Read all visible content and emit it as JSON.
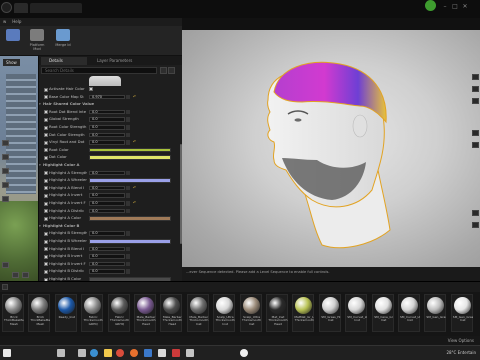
{
  "window": {
    "tab1": "",
    "tab2": "",
    "help_menu": [
      "w",
      "Help"
    ],
    "top_right_text": ""
  },
  "toolbar": {
    "tools": [
      {
        "label": "",
        "color": "#5a7bbd"
      },
      {
        "label": "Platform Mod",
        "color": "#888888"
      },
      {
        "label": "Merge Id",
        "color": "#6a9acf"
      }
    ]
  },
  "left_viewport": {
    "show_label": "Show"
  },
  "details": {
    "tab_details": "Details",
    "tab_layer": "Layer Parameters",
    "search_placeholder": "Search Details",
    "rows": [
      {
        "type": "check",
        "label": "Activate Hair Color",
        "checked": true,
        "vcheck": true
      },
      {
        "type": "value",
        "label": "Base Color Map St",
        "checked": true,
        "value": "0.970",
        "reset": true
      },
      {
        "type": "section",
        "label": "Hair Shared Color Value"
      },
      {
        "type": "value",
        "label": "Root Dot Blend Inte",
        "checked": true,
        "value": "0.0"
      },
      {
        "type": "value",
        "label": "Global Strength",
        "checked": true,
        "value": "0.0"
      },
      {
        "type": "value",
        "label": "Root Color Strength",
        "checked": true,
        "value": "0.0"
      },
      {
        "type": "value",
        "label": "Dot Color Strength",
        "checked": true,
        "value": "0.0"
      },
      {
        "type": "value",
        "label": "Vinyl Root and Dot",
        "checked": true,
        "value": "0.0",
        "reset": true
      },
      {
        "type": "color",
        "label": "Root Color",
        "checked": true,
        "color": "#a8c23a"
      },
      {
        "type": "color",
        "label": "Dot Color",
        "checked": true,
        "color": "#dfe56a"
      },
      {
        "type": "section",
        "label": "Highlight Color A"
      },
      {
        "type": "value",
        "label": "Highlight A Strength",
        "checked": true,
        "value": "0.0"
      },
      {
        "type": "color",
        "label": "Highlight A Wheeler",
        "checked": true,
        "color": "#9aa0e8"
      },
      {
        "type": "value",
        "label": "Highlight A Blend I",
        "checked": true,
        "value": "0.0",
        "reset": true
      },
      {
        "type": "value",
        "label": "Highlight A Invert",
        "checked": true,
        "value": "0.0"
      },
      {
        "type": "value",
        "label": "Highlight A Invert F",
        "checked": true,
        "value": "0.0",
        "reset": true
      },
      {
        "type": "value",
        "label": "Highlight A Distrib",
        "checked": true,
        "value": "0.0"
      },
      {
        "type": "color",
        "label": "Highlight A Color",
        "checked": true,
        "color": "#a07a58"
      },
      {
        "type": "section",
        "label": "Highlight Color B"
      },
      {
        "type": "value",
        "label": "Highlight B Strength",
        "checked": true,
        "value": "0.0"
      },
      {
        "type": "color",
        "label": "Highlight B Wheeler",
        "checked": true,
        "color": "#9aa0e8"
      },
      {
        "type": "value",
        "label": "Highlight B Blend I",
        "checked": true,
        "value": "0.0"
      },
      {
        "type": "value",
        "label": "Highlight B Invert",
        "checked": true,
        "value": "0.0"
      },
      {
        "type": "value",
        "label": "Highlight B Invert F",
        "checked": true,
        "value": "0.0"
      },
      {
        "type": "value",
        "label": "Highlight B Distrib",
        "checked": true,
        "value": "0.0"
      },
      {
        "type": "color",
        "label": "Highlight B Color",
        "checked": true,
        "color": "#4a4a4a"
      }
    ]
  },
  "viewport": {
    "info_text": "...ever Sequence detected. Please add a Level Sequence to enable full controls."
  },
  "content_browser": {
    "assets": [
      {
        "name": "Brick ThickBakeMap Mesh",
        "color": "#8a8a8a"
      },
      {
        "name": "Brick ThickBakeMap Mesh",
        "color": "#7c7c7c"
      },
      {
        "name": "Ready_Inst",
        "color": "#1b58a8"
      },
      {
        "name": "Fabric Thicksmooth GRHQ",
        "color": "#8b8b8b"
      },
      {
        "name": "Fabric Thicksmooth GRHQ",
        "color": "#5a5a5a"
      },
      {
        "name": "Male_Barber Thicksmooth Head",
        "color": "#7a5a92"
      },
      {
        "name": "Male_Barber Thicksmooth Head",
        "color": "#4d4d4d"
      },
      {
        "name": "Male_Barber Thicksmooth Inst",
        "color": "#6d6d6d"
      },
      {
        "name": "Scalp_Ultra Thicksmooth Inst",
        "color": "#d8d8d8"
      },
      {
        "name": "Scalp_Ultra Thicksmooth Inst",
        "color": "#9a8a78"
      },
      {
        "name": "Mat_Inst Thicksmooth Head",
        "color": "#2a2a2a"
      },
      {
        "name": "MatMat_Gr_Lv Thicksmooth",
        "color": "#b8c254"
      },
      {
        "name": "SM_Grass_Hi Inst",
        "color": "#cfcfcf"
      },
      {
        "name": "SM_Curvat_Lt Inst",
        "color": "#d6d6d6"
      },
      {
        "name": "SM_Cane_Gr Inst",
        "color": "#e0e0e0"
      },
      {
        "name": "SM_Curvat_Lt Inst",
        "color": "#d4d4d4"
      },
      {
        "name": "SM_Gen_Grass",
        "color": "#bdbdbd"
      },
      {
        "name": "SM_Gen_Grass_Lt Inst",
        "color": "#e6e6e6"
      }
    ],
    "view_options": "View Options"
  },
  "taskbar": {
    "weather": "28°C  Entertain",
    "icons": [
      {
        "name": "start",
        "color": "#e8e8e8"
      },
      {
        "name": "search",
        "color": "#bdbdbd"
      },
      {
        "name": "taskview",
        "color": "#bdbdbd"
      },
      {
        "name": "edge",
        "color": "#3b8fd0"
      },
      {
        "name": "files",
        "color": "#f2c94c"
      },
      {
        "name": "chrome",
        "color": "#d94c3b"
      },
      {
        "name": "firefox",
        "color": "#e8712e"
      },
      {
        "name": "store",
        "color": "#3b78c9"
      },
      {
        "name": "mail",
        "color": "#d9d9d9"
      },
      {
        "name": "app1",
        "color": "#cc3a3a"
      },
      {
        "name": "app2",
        "color": "#c4c4c4"
      },
      {
        "name": "unreal",
        "color": "#efefef"
      }
    ]
  }
}
